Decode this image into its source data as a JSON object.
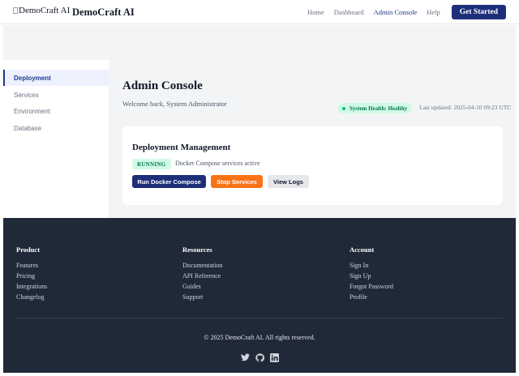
{
  "header": {
    "logo_alt": "DemoCraft AI",
    "brand": "DemoCraft AI",
    "nav": [
      "Home",
      "Dashboard",
      "Admin Console",
      "Help"
    ],
    "cta": "Get Started"
  },
  "sidebar": {
    "items": [
      "Deployment",
      "Services",
      "Environment",
      "Database"
    ]
  },
  "main": {
    "title": "Admin Console",
    "welcome": "Welcome back, System Administrator",
    "health": "System Health: Healthy",
    "updated": "Last updated: 2025-04-10 09:23 UTC",
    "card": {
      "title": "Deployment Management",
      "status": "RUNNING",
      "status_text": "Docker Compose services active",
      "run": "Run Docker Compose",
      "stop": "Stop Services",
      "logs": "View Logs"
    }
  },
  "footer": {
    "product": {
      "heading": "Product",
      "links": [
        "Features",
        "Pricing",
        "Integrations",
        "Changelog"
      ]
    },
    "resources": {
      "heading": "Resources",
      "links": [
        "Documentation",
        "API Reference",
        "Guides",
        "Support"
      ]
    },
    "account": {
      "heading": "Account",
      "links": [
        "Sign In",
        "Sign Up",
        "Forgot Password",
        "Profile"
      ]
    },
    "copyright": "© 2025 DemoCraft AI. All rights reserved.",
    "social_icons": [
      "twitter-icon",
      "github-icon",
      "linkedin-icon"
    ]
  },
  "colors": {
    "primary": "#1e2f7a",
    "orange": "#f97316",
    "success_bg": "#d1fae5",
    "success_text": "#047857",
    "footer_bg": "#1f2937"
  }
}
